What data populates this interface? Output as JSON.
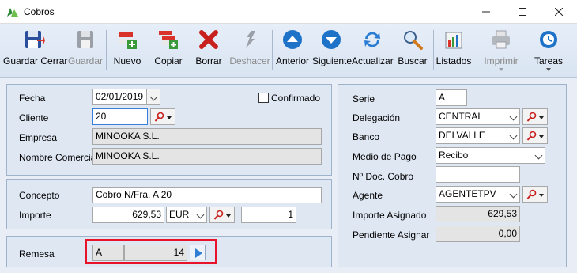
{
  "window": {
    "title": "Cobros"
  },
  "toolbar": {
    "save_close": "Guardar Cerrar",
    "save": "Guardar",
    "new": "Nuevo",
    "copy": "Copiar",
    "delete": "Borrar",
    "undo": "Deshacer",
    "previous": "Anterior",
    "next": "Siguiente",
    "refresh": "Actualizar",
    "search": "Buscar",
    "listings": "Listados",
    "print": "Imprimir",
    "tasks": "Tareas"
  },
  "form": {
    "fecha_label": "Fecha",
    "fecha_value": "02/01/2019",
    "confirmado_label": "Confirmado",
    "cliente_label": "Cliente",
    "cliente_value": "20",
    "empresa_label": "Empresa",
    "empresa_value": "MINOOKA S.L.",
    "nombre_comercial_label": "Nombre Comercial",
    "nombre_comercial_value": "MINOOKA S.L.",
    "concepto_label": "Concepto",
    "concepto_value": "Cobro N/Fra. A 20",
    "importe_label": "Importe",
    "importe_value": "629,53",
    "currency_value": "EUR",
    "exchange_value": "1",
    "remesa_label": "Remesa",
    "remesa_serie": "A",
    "remesa_number": "14",
    "serie_label": "Serie",
    "serie_value": "A",
    "delegacion_label": "Delegación",
    "delegacion_value": "CENTRAL",
    "banco_label": "Banco",
    "banco_value": "DELVALLE",
    "medio_pago_label": "Medio de Pago",
    "medio_pago_value": "Recibo",
    "num_doc_label": "Nº Doc. Cobro",
    "num_doc_value": "",
    "agente_label": "Agente",
    "agente_value": "AGENTETPV",
    "importe_asignado_label": "Importe Asignado",
    "importe_asignado_value": "629,53",
    "pendiente_asignar_label": "Pendiente Asignar",
    "pendiente_asignar_value": "0,00"
  },
  "colors": {
    "highlight": "#e8132a",
    "panel": "#dfe7f3",
    "accent": "#2f7fd4"
  }
}
